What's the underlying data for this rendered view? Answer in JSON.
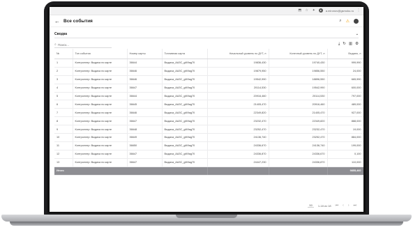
{
  "browser": {
    "user": "a.mironov@gsmoku.ru"
  },
  "header": {
    "title": "Все события"
  },
  "select": {
    "value": "Сводка"
  },
  "search": {
    "placeholder": "Поиск..."
  },
  "table": {
    "columns": [
      "№",
      "Тип события",
      "Номер карты",
      "Топливная карта",
      "Начальный уровень по ДУТ, л",
      "Конечный уровень по ДУТ, л",
      "Выдано, л"
    ],
    "rows": [
      [
        "1",
        "Контроллер: Выдача по карте",
        "36644",
        "Выдача_ААЗС_gf49ag70",
        "19836,430",
        "19740,430",
        "999,990"
      ],
      [
        "2",
        "Контроллер: Выдача по карте",
        "36646",
        "Выдача_ААЗС_gf49ag70",
        "19879,950",
        "19856,550",
        "24,000"
      ],
      [
        "3",
        "Контроллер: Выдача по карте",
        "36646",
        "Выдача_ААЗС_gf49ag70",
        "19542,990",
        "18896,550",
        "665,990"
      ],
      [
        "4",
        "Контроллер: Выдача по карте",
        "36647",
        "Выдача_ААЗС_gf49ag70",
        "20114,530",
        "19542,990",
        "600,000"
      ],
      [
        "5",
        "Контроллер: Выдача по карте",
        "36644",
        "Выдача_ААЗС_gf49ag70",
        "20916,460",
        "20114,530",
        "797,000"
      ],
      [
        "6",
        "Контроллер: Выдача по карте",
        "36645",
        "Выдача_ААЗС_gf49ag70",
        "21405,470",
        "20916,460",
        "489,000"
      ],
      [
        "7",
        "Контроллер: Выдача по карте",
        "36646",
        "Выдача_ААЗС_gf49ag70",
        "22349,820",
        "21405,470",
        "927,000"
      ],
      [
        "8",
        "Контроллер: Выдача по карте",
        "36647",
        "Выдача_ААЗС_gf49ag70",
        "23232,470",
        "22349,820",
        "888,000"
      ],
      [
        "9",
        "Контроллер: Выдача по карте",
        "36648",
        "Выдача_ААЗС_gf49ag70",
        "23252,470",
        "23232,470",
        "19,000"
      ],
      [
        "10",
        "Контроллер: Выдача по карте",
        "36649",
        "Выдача_ААЗС_gf49ag70",
        "24136,740",
        "23252,470",
        "884,000"
      ],
      [
        "11",
        "Контроллер: Выдача по карте",
        "36650",
        "Выдача_ААЗС_gf49ag70",
        "24336,670",
        "24136,740",
        "199,000"
      ],
      [
        "12",
        "Контроллер: Выдача по карте",
        "36647",
        "Выдача_ААЗС_gf49ag70",
        "24336,870",
        "24336,670",
        "0,100"
      ],
      [
        "13",
        "Контроллер: Выдача по карте",
        "36647",
        "Выдача_ААЗС_gf49ag70",
        "24447,230",
        "24336,870",
        "110,000"
      ]
    ],
    "total": {
      "label": "Итого",
      "value": "9855,460"
    }
  },
  "pager": {
    "page_size": "50",
    "range": "1-18 из 18"
  },
  "colors": {
    "accent_warn": "#f3a000",
    "total_row": "#8e8e93"
  }
}
